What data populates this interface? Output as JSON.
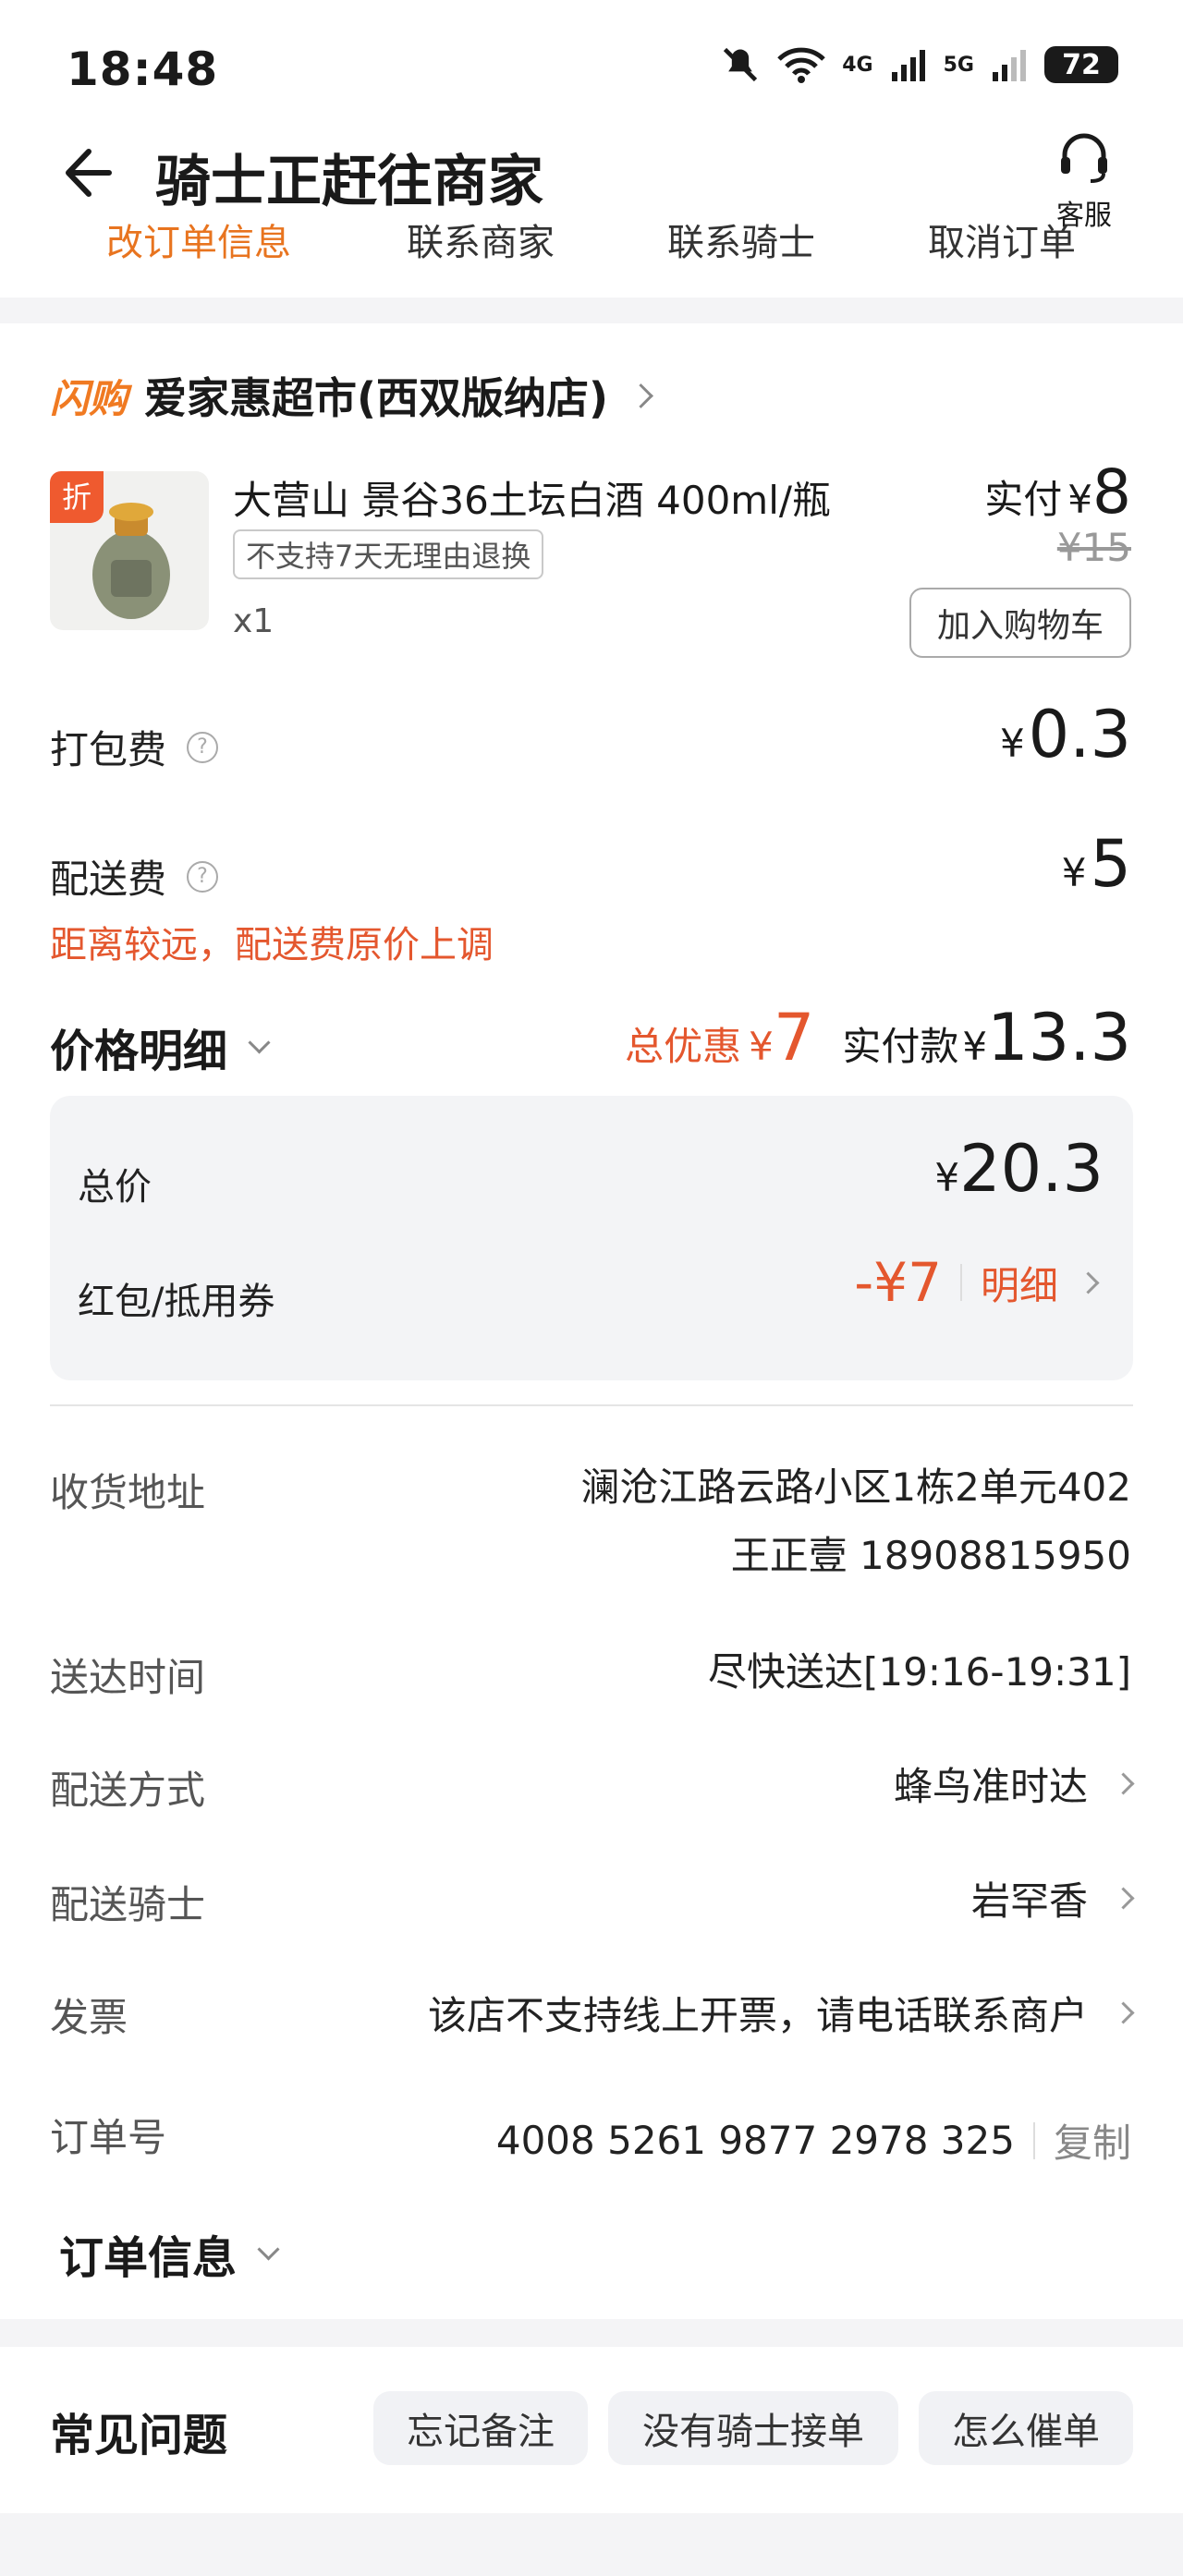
{
  "status_bar": {
    "time": "18:48",
    "battery": "72",
    "net1": "4G",
    "net2": "5G"
  },
  "header": {
    "title": "骑士正赶往商家",
    "cs_label": "客服"
  },
  "tabs": [
    "改订单信息",
    "联系商家",
    "联系骑士",
    "取消订单"
  ],
  "shop": {
    "badge": "闪购",
    "name": "爱家惠超市(西双版纳店)"
  },
  "product": {
    "discount_tag": "折",
    "name": "大营山 景谷36土坛白酒 400ml/瓶",
    "tag": "不支持7天无理由退换",
    "qty": "x1",
    "paid_label": "实付",
    "yen": "¥",
    "paid_value": "8",
    "orig_price": "¥15",
    "add_cart": "加入购物车"
  },
  "fees": {
    "packing_label": "打包费",
    "packing_value": "0.3",
    "delivery_label": "配送费",
    "delivery_value": "5",
    "delivery_warning": "距离较远，配送费原价上调"
  },
  "price_detail": {
    "title": "价格明细",
    "discount_label": "总优惠",
    "discount_value": "7",
    "paid_label": "实付款",
    "paid_value": "13.3",
    "total_label": "总价",
    "total_value": "20.3",
    "coupon_label": "红包/抵用券",
    "coupon_value": "-¥7",
    "detail_link": "明细"
  },
  "info": {
    "address_label": "收货地址",
    "address_line1": "澜沧江路云路小区1栋2单元402",
    "address_line2": "王正壹 18908815950",
    "time_label": "送达时间",
    "time_value": "尽快送达[19:16-19:31]",
    "method_label": "配送方式",
    "method_value": "蜂鸟准时达",
    "rider_label": "配送骑士",
    "rider_value": "岩罕香",
    "invoice_label": "发票",
    "invoice_value": "该店不支持线上开票，请电话联系商户",
    "order_no_label": "订单号",
    "order_no_value": "4008 5261 9877 2978 325",
    "copy_label": "复制",
    "order_info_title": "订单信息"
  },
  "faq": {
    "title": "常见问题",
    "chips": [
      "忘记备注",
      "没有骑士接单",
      "怎么催单"
    ]
  },
  "colors": {
    "accent": "#f07a22",
    "red": "#e4572e"
  }
}
